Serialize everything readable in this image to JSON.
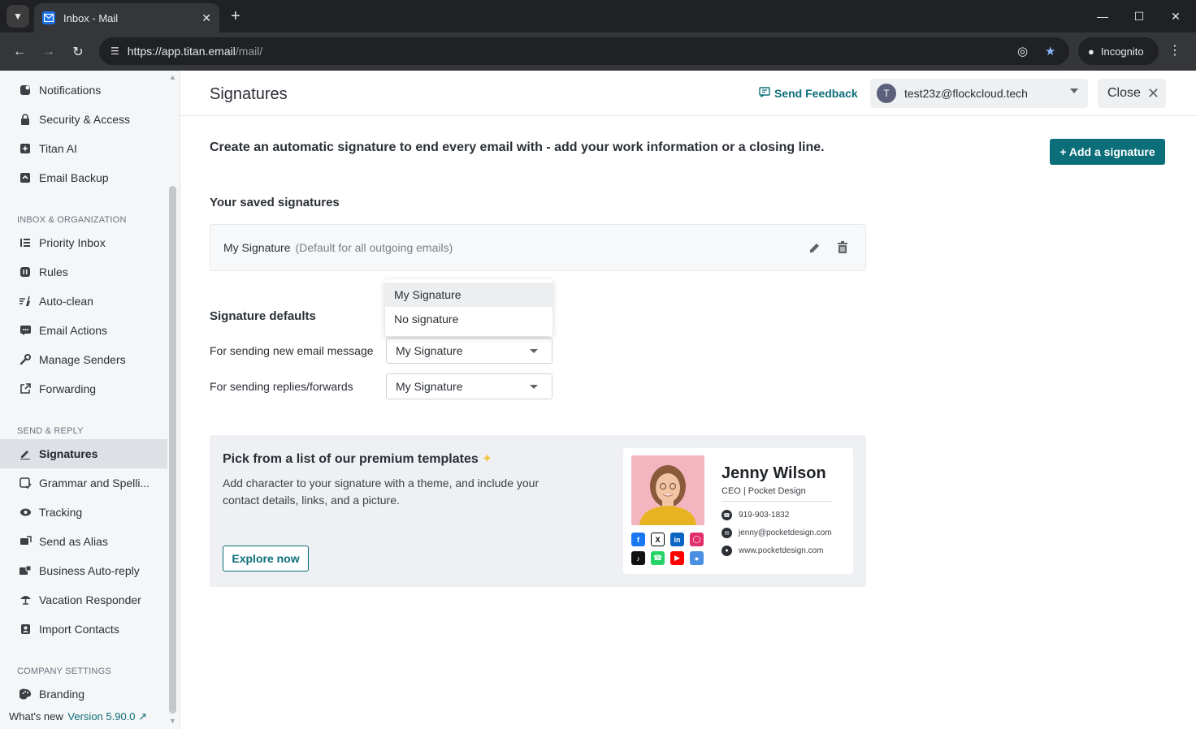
{
  "browser": {
    "tab_title": "Inbox - Mail",
    "url_host": "https://app.titan.email",
    "url_path": "/mail/",
    "incognito_label": "Incognito"
  },
  "sidebar": {
    "top_items": [
      {
        "label": "Notifications",
        "icon": "bell-icon"
      },
      {
        "label": "Security & Access",
        "icon": "lock-icon"
      },
      {
        "label": "Titan AI",
        "icon": "sparkle-icon"
      },
      {
        "label": "Email Backup",
        "icon": "backup-icon"
      }
    ],
    "section_inbox": "INBOX & ORGANIZATION",
    "inbox_items": [
      {
        "label": "Priority Inbox",
        "icon": "priority-icon"
      },
      {
        "label": "Rules",
        "icon": "rules-icon"
      },
      {
        "label": "Auto-clean",
        "icon": "broom-icon"
      },
      {
        "label": "Email Actions",
        "icon": "actions-icon"
      },
      {
        "label": "Manage Senders",
        "icon": "wrench-icon"
      },
      {
        "label": "Forwarding",
        "icon": "forward-icon"
      }
    ],
    "section_send": "SEND & REPLY",
    "send_items": [
      {
        "label": "Signatures",
        "icon": "pen-icon",
        "active": true
      },
      {
        "label": "Grammar and Spelli...",
        "icon": "grammar-icon"
      },
      {
        "label": "Tracking",
        "icon": "eye-icon"
      },
      {
        "label": "Send as Alias",
        "icon": "alias-icon"
      },
      {
        "label": "Business Auto-reply",
        "icon": "auto-reply-icon"
      },
      {
        "label": "Vacation Responder",
        "icon": "umbrella-icon"
      },
      {
        "label": "Import Contacts",
        "icon": "contacts-icon"
      }
    ],
    "section_company": "COMPANY SETTINGS",
    "company_items": [
      {
        "label": "Branding",
        "icon": "palette-icon"
      }
    ],
    "whats_new": "What's new",
    "version": "Version 5.90.0"
  },
  "header": {
    "title": "Signatures",
    "feedback": "Send Feedback",
    "account_initial": "T",
    "account_email": "test23z@flockcloud.tech",
    "close_label": "Close"
  },
  "content": {
    "intro": "Create an automatic signature to end every email with - add your work information or a closing line.",
    "add_button": "+ Add a signature",
    "saved_heading": "Your saved signatures",
    "saved_signature_name": "My Signature",
    "saved_signature_default": "(Default for all outgoing emails)",
    "defaults_heading": "Signature defaults",
    "new_email_label": "For sending new email message",
    "new_email_value": "My Signature",
    "replies_label": "For sending replies/forwards",
    "replies_value": "My Signature",
    "dropdown_options": [
      "My Signature",
      "No signature"
    ]
  },
  "promo": {
    "title": "Pick from a list of our premium templates",
    "description": "Add character to your signature with a theme, and include your contact details, links, and a picture.",
    "explore_button": "Explore now",
    "template": {
      "name": "Jenny Wilson",
      "role": "CEO | Pocket Design",
      "phone": "919-903-1832",
      "email": "jenny@pocketdesign.com",
      "website": "www.pocketdesign.com"
    }
  },
  "colors": {
    "accent": "#0b6e79",
    "sidebar_bg": "#f5f6f7",
    "active_item": "#dde0e4"
  }
}
